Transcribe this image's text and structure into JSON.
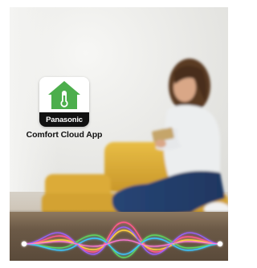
{
  "app": {
    "brand": "Panasonic",
    "caption": "Comfort Cloud App",
    "icon": "house-thermometer-icon"
  },
  "colors": {
    "icon_green": "#4cae4c",
    "brand_bar": "#111111",
    "sofa_yellow": "#e2b43a",
    "jeans_blue": "#2b4a7c",
    "wave_colors": [
      "#ff5a3c",
      "#ffd23c",
      "#5ad05a",
      "#3cc8ff",
      "#8a5aff",
      "#ff5ac8"
    ]
  }
}
